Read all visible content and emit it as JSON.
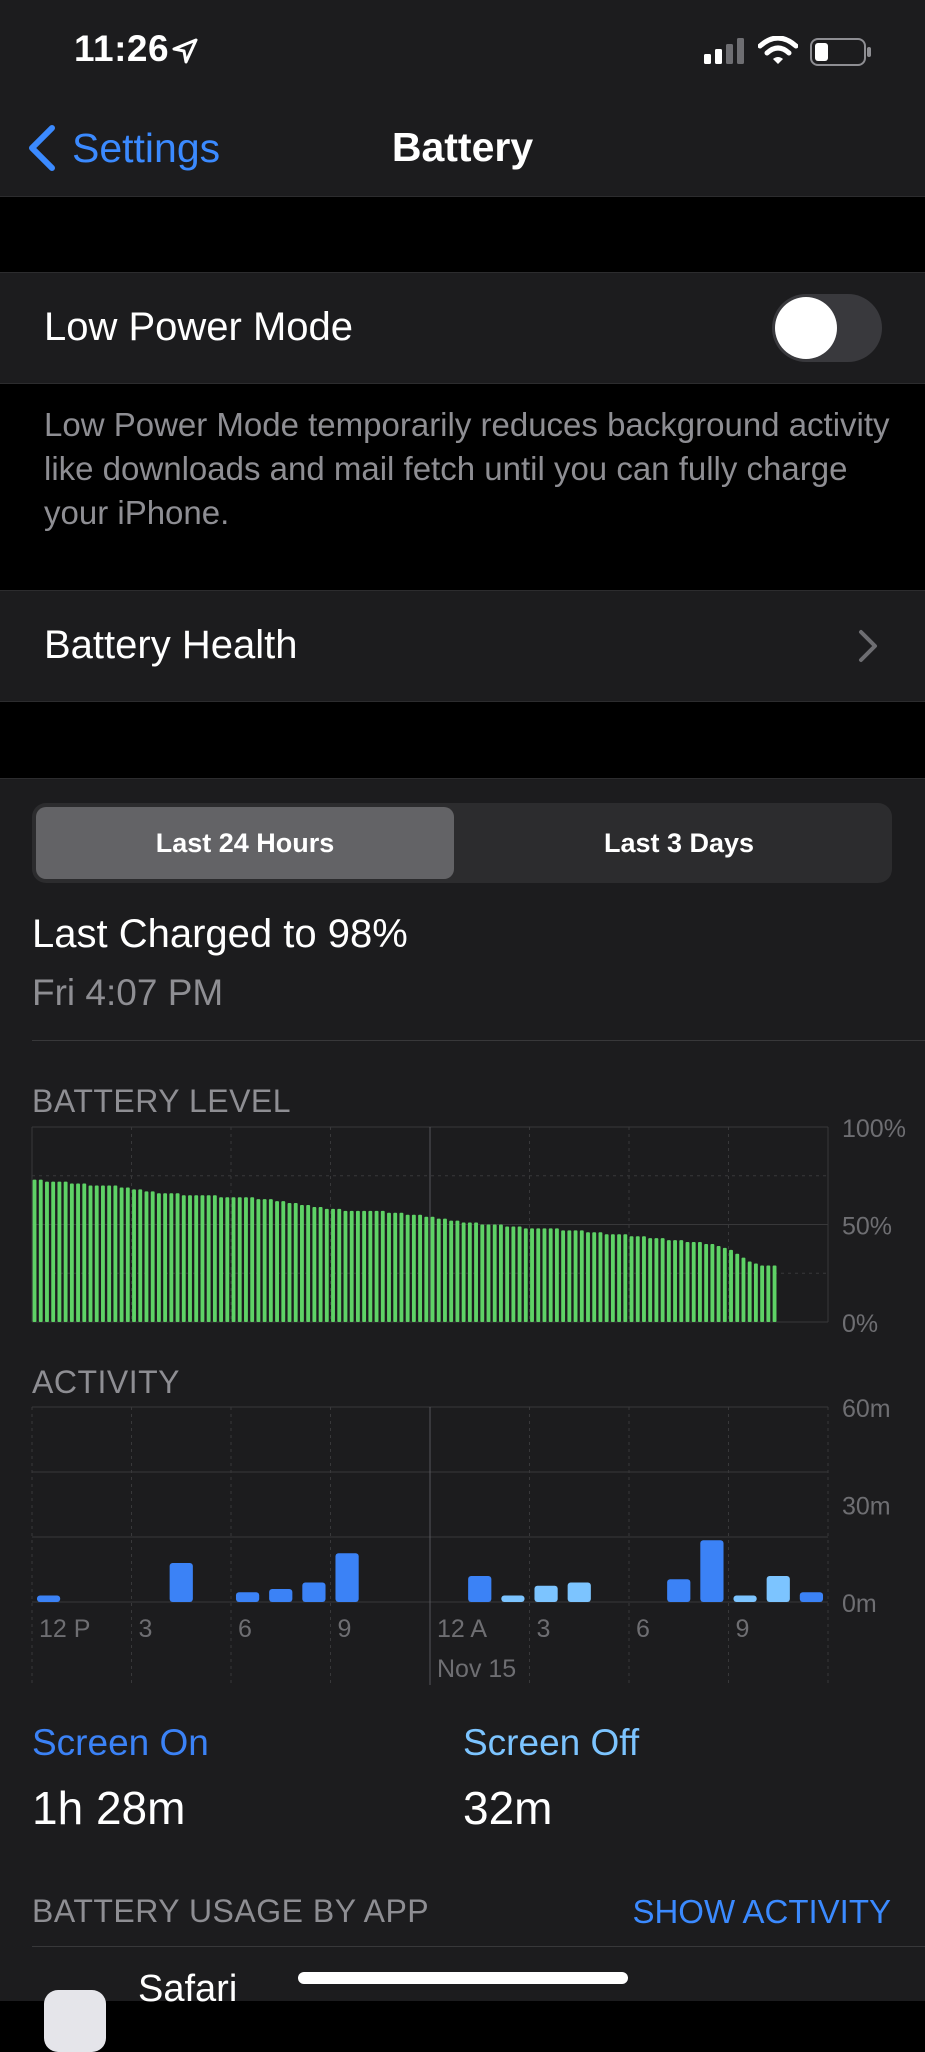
{
  "status_bar": {
    "time": "11:26",
    "icons": [
      "location-arrow-icon",
      "cellular-signal-icon",
      "wifi-icon",
      "battery-icon"
    ]
  },
  "nav": {
    "back_label": "Settings",
    "title": "Battery"
  },
  "low_power": {
    "label": "Low Power Mode",
    "enabled": false,
    "footer": "Low Power Mode temporarily reduces background activity like downloads and mail fetch until you can fully charge your iPhone."
  },
  "battery_health": {
    "label": "Battery Health"
  },
  "segmented": {
    "options": [
      "Last 24 Hours",
      "Last 3 Days"
    ],
    "selected": 0
  },
  "last_charged": {
    "title": "Last Charged to 98%",
    "time": "Fri 4:07 PM"
  },
  "colors": {
    "accent": "#3b8aff",
    "battery_bar": "#5ed266",
    "screen_on": "#3b82f6",
    "screen_off": "#7cc4ff"
  },
  "chart_data": [
    {
      "type": "bar",
      "title": "BATTERY LEVEL",
      "y_tick_labels": [
        "100%",
        "50%",
        "0%"
      ],
      "ylim": [
        0,
        100
      ],
      "values": [
        73,
        73,
        72,
        72,
        72,
        72,
        71,
        71,
        71,
        70,
        70,
        70,
        70,
        70,
        69,
        69,
        68,
        68,
        67,
        67,
        66,
        66,
        66,
        66,
        65,
        65,
        65,
        65,
        65,
        65,
        64,
        64,
        64,
        64,
        64,
        64,
        63,
        63,
        63,
        62,
        62,
        61,
        61,
        60,
        60,
        59,
        59,
        58,
        58,
        58,
        57,
        57,
        57,
        57,
        57,
        57,
        57,
        56,
        56,
        56,
        55,
        55,
        55,
        54,
        54,
        53,
        53,
        52,
        52,
        51,
        51,
        51,
        50,
        50,
        50,
        50,
        49,
        49,
        49,
        48,
        48,
        48,
        48,
        48,
        48,
        47,
        47,
        47,
        47,
        46,
        46,
        46,
        45,
        45,
        45,
        45,
        44,
        44,
        44,
        43,
        43,
        43,
        42,
        42,
        42,
        41,
        41,
        41,
        40,
        40,
        39,
        38,
        37,
        35,
        33,
        31,
        30,
        29,
        29,
        29
      ],
      "grid": true
    },
    {
      "type": "bar",
      "title": "ACTIVITY",
      "y_tick_labels": [
        "60m",
        "30m",
        "0m"
      ],
      "ylim": [
        0,
        60
      ],
      "x_tick_labels": [
        "12 P",
        "3",
        "6",
        "9",
        "12 A",
        "3",
        "6",
        "9"
      ],
      "date_label": "Nov 15",
      "series": [
        {
          "name": "Screen On",
          "hours": [
            0,
            4,
            6,
            7,
            8,
            9,
            13,
            19,
            20,
            23
          ],
          "values": [
            2,
            12,
            3,
            4,
            6,
            15,
            8,
            7,
            19,
            3
          ]
        },
        {
          "name": "Screen Off",
          "hours": [
            14,
            15,
            16,
            21,
            22
          ],
          "values": [
            2,
            5,
            6,
            2,
            8
          ]
        }
      ],
      "grid": true
    }
  ],
  "screen_on": {
    "label": "Screen On",
    "value": "1h 28m"
  },
  "screen_off": {
    "label": "Screen Off",
    "value": "32m"
  },
  "usage": {
    "label": "BATTERY USAGE BY APP",
    "link": "SHOW ACTIVITY"
  },
  "apps": [
    {
      "name": "Safari"
    }
  ]
}
